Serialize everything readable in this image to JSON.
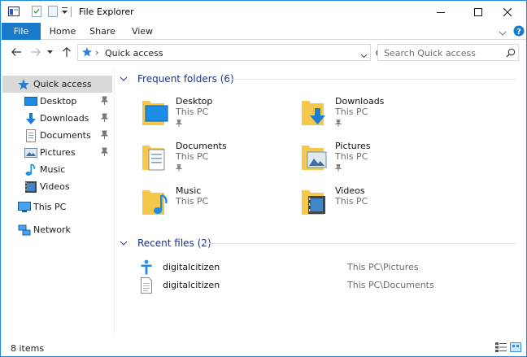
{
  "window": {
    "title": "File Explorer"
  },
  "ribbon": {
    "file": "File",
    "tabs": [
      "Home",
      "Share",
      "View"
    ]
  },
  "address": {
    "path": "Quick access",
    "separator": "›"
  },
  "search": {
    "placeholder": "Search Quick access"
  },
  "sidebar": {
    "quick_access": "Quick access",
    "pinned": [
      {
        "label": "Desktop",
        "icon": "desktop-icon"
      },
      {
        "label": "Downloads",
        "icon": "downloads-icon"
      },
      {
        "label": "Documents",
        "icon": "documents-icon"
      },
      {
        "label": "Pictures",
        "icon": "pictures-icon"
      },
      {
        "label": "Music",
        "icon": "music-icon"
      },
      {
        "label": "Videos",
        "icon": "videos-icon"
      }
    ],
    "this_pc": "This PC",
    "network": "Network"
  },
  "frequent": {
    "title": "Frequent folders (6)",
    "items": [
      {
        "name": "Desktop",
        "location": "This PC"
      },
      {
        "name": "Downloads",
        "location": "This PC"
      },
      {
        "name": "Documents",
        "location": "This PC"
      },
      {
        "name": "Pictures",
        "location": "This PC"
      },
      {
        "name": "Music",
        "location": "This PC"
      },
      {
        "name": "Videos",
        "location": "This PC"
      }
    ]
  },
  "recent": {
    "title": "Recent files (2)",
    "items": [
      {
        "name": "digitalcitizen",
        "path": "This PC\\Pictures"
      },
      {
        "name": "digitalcitizen",
        "path": "This PC\\Documents"
      }
    ]
  },
  "status": {
    "count": "8 items"
  },
  "colors": {
    "accent": "#1979ca",
    "heading": "#1e3287",
    "selected": "#cce8ff"
  }
}
